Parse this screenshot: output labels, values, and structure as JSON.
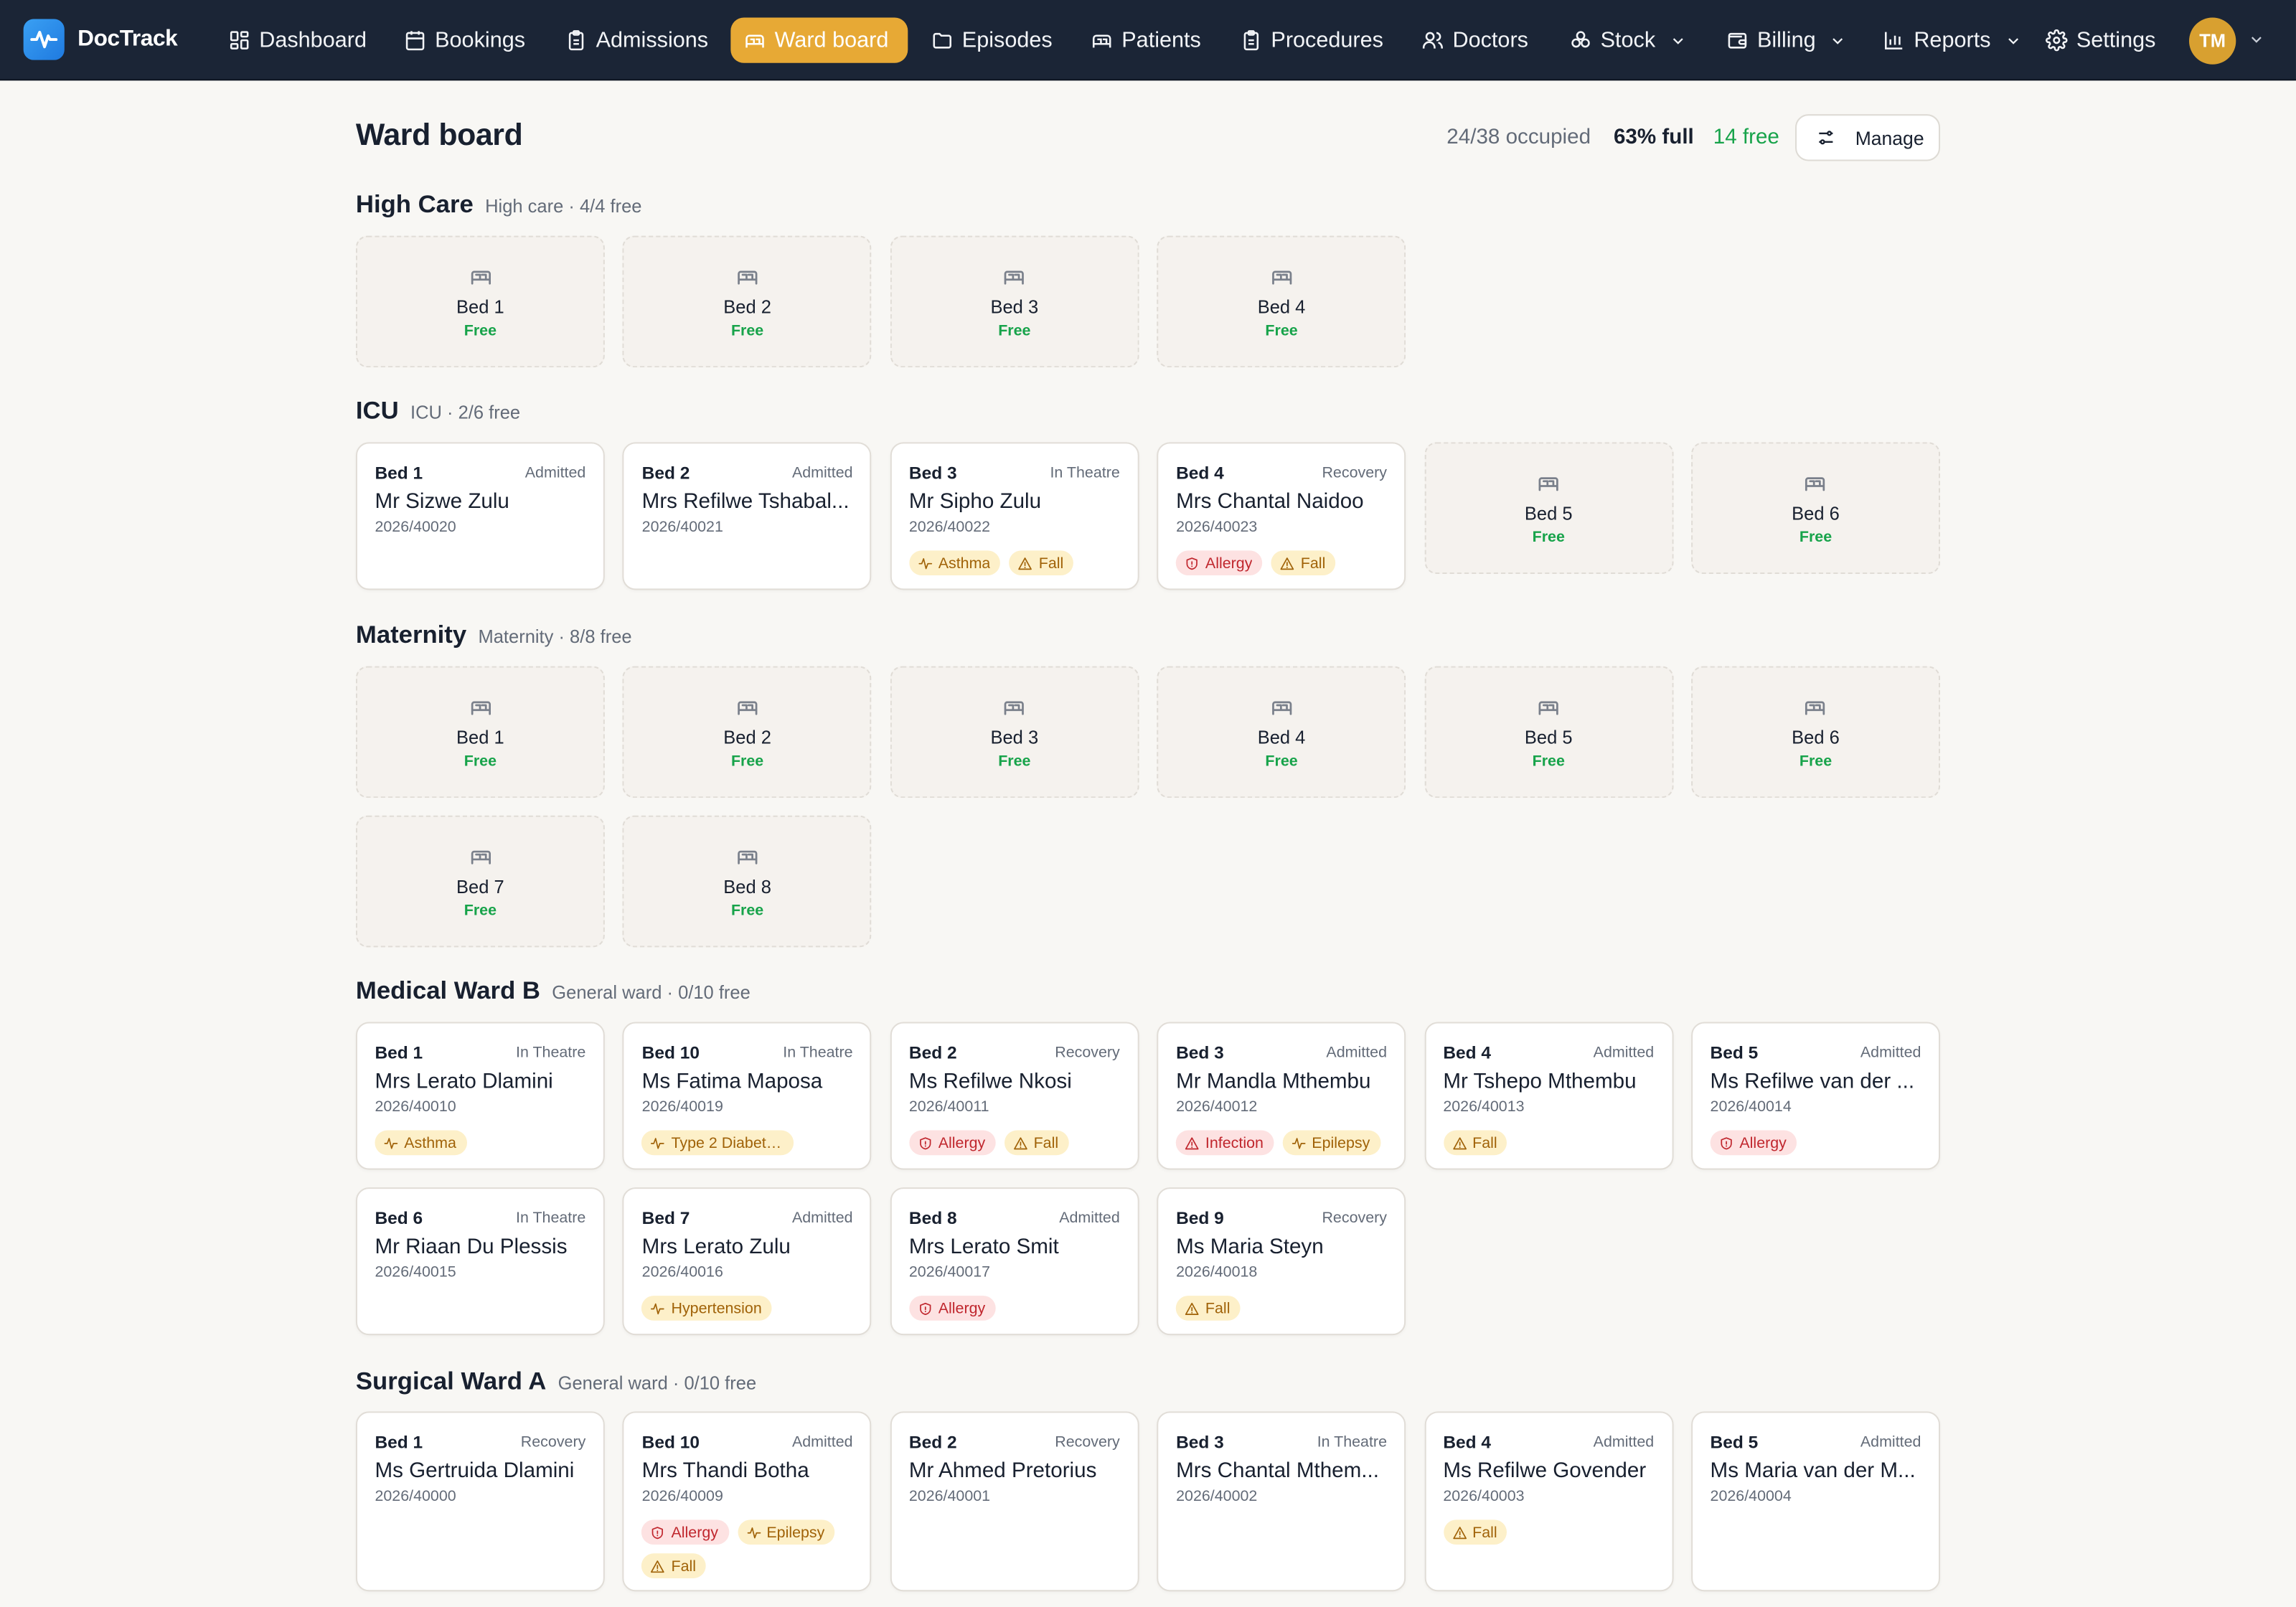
{
  "app": {
    "name": "DocTrack"
  },
  "nav": {
    "items": [
      {
        "label": "Dashboard",
        "icon": "dashboard-icon"
      },
      {
        "label": "Bookings",
        "icon": "calendar-icon"
      },
      {
        "label": "Admissions",
        "icon": "clipboard-icon"
      },
      {
        "label": "Ward board",
        "icon": "bed-icon",
        "active": true
      },
      {
        "label": "Episodes",
        "icon": "folder-icon"
      },
      {
        "label": "Patients",
        "icon": "bed-icon"
      },
      {
        "label": "Procedures",
        "icon": "clipboard-icon"
      },
      {
        "label": "Doctors",
        "icon": "users-icon"
      },
      {
        "label": "Stock",
        "icon": "boxes-icon",
        "dropdown": true
      },
      {
        "label": "Billing",
        "icon": "wallet-icon",
        "dropdown": true
      },
      {
        "label": "Reports",
        "icon": "bar-chart-icon",
        "dropdown": true
      },
      {
        "label": "Settings",
        "icon": "gear-icon"
      }
    ],
    "user_initials": "TM"
  },
  "header": {
    "title": "Ward board",
    "occupied": "24/38 occupied",
    "full": "63% full",
    "free": "14 free",
    "manage_label": "Manage"
  },
  "colors": {
    "nav_bg": "#1b2536",
    "accent": "#e7a935",
    "free": "#17a34a",
    "alert_red": "#c0262d",
    "alert_amber": "#a06208"
  },
  "wards": [
    {
      "name": "High Care",
      "summary": "High care · 4/4 free",
      "beds": [
        {
          "bed": "Bed 1",
          "free": true,
          "status": "Free"
        },
        {
          "bed": "Bed 2",
          "free": true,
          "status": "Free"
        },
        {
          "bed": "Bed 3",
          "free": true,
          "status": "Free"
        },
        {
          "bed": "Bed 4",
          "free": true,
          "status": "Free"
        }
      ]
    },
    {
      "name": "ICU",
      "summary": "ICU · 2/6 free",
      "beds": [
        {
          "bed": "Bed 1",
          "status": "Admitted",
          "patient": "Mr Sizwe Zulu",
          "ref": "2026/40020",
          "tags": []
        },
        {
          "bed": "Bed 2",
          "status": "Admitted",
          "patient": "Mrs Refilwe Tshabal...",
          "ref": "2026/40021",
          "tags": []
        },
        {
          "bed": "Bed 3",
          "status": "In Theatre",
          "patient": "Mr Sipho Zulu",
          "ref": "2026/40022",
          "tags": [
            {
              "label": "Asthma",
              "kind": "amber",
              "icon": "pulse-icon"
            },
            {
              "label": "Fall",
              "kind": "amber",
              "icon": "warning-icon"
            }
          ]
        },
        {
          "bed": "Bed 4",
          "status": "Recovery",
          "patient": "Mrs Chantal Naidoo",
          "ref": "2026/40023",
          "tags": [
            {
              "label": "Allergy",
              "kind": "red",
              "icon": "shield-icon"
            },
            {
              "label": "Fall",
              "kind": "amber",
              "icon": "warning-icon"
            }
          ]
        },
        {
          "bed": "Bed 5",
          "free": true,
          "status": "Free"
        },
        {
          "bed": "Bed 6",
          "free": true,
          "status": "Free"
        }
      ]
    },
    {
      "name": "Maternity",
      "summary": "Maternity · 8/8 free",
      "beds": [
        {
          "bed": "Bed 1",
          "free": true,
          "status": "Free"
        },
        {
          "bed": "Bed 2",
          "free": true,
          "status": "Free"
        },
        {
          "bed": "Bed 3",
          "free": true,
          "status": "Free"
        },
        {
          "bed": "Bed 4",
          "free": true,
          "status": "Free"
        },
        {
          "bed": "Bed 5",
          "free": true,
          "status": "Free"
        },
        {
          "bed": "Bed 6",
          "free": true,
          "status": "Free"
        },
        {
          "bed": "Bed 7",
          "free": true,
          "status": "Free"
        },
        {
          "bed": "Bed 8",
          "free": true,
          "status": "Free"
        }
      ]
    },
    {
      "name": "Medical Ward B",
      "summary": "General ward · 0/10 free",
      "beds": [
        {
          "bed": "Bed 1",
          "status": "In Theatre",
          "patient": "Mrs Lerato Dlamini",
          "ref": "2026/40010",
          "tags": [
            {
              "label": "Asthma",
              "kind": "amber",
              "icon": "pulse-icon"
            }
          ]
        },
        {
          "bed": "Bed 10",
          "status": "In Theatre",
          "patient": "Ms Fatima Maposa",
          "ref": "2026/40019",
          "tags": [
            {
              "label": "Type 2 Diabete...",
              "kind": "amber",
              "icon": "pulse-icon"
            }
          ]
        },
        {
          "bed": "Bed 2",
          "status": "Recovery",
          "patient": "Ms Refilwe Nkosi",
          "ref": "2026/40011",
          "tags": [
            {
              "label": "Allergy",
              "kind": "red",
              "icon": "shield-icon"
            },
            {
              "label": "Fall",
              "kind": "amber",
              "icon": "warning-icon"
            }
          ]
        },
        {
          "bed": "Bed 3",
          "status": "Admitted",
          "patient": "Mr Mandla Mthembu",
          "ref": "2026/40012",
          "tags": [
            {
              "label": "Infection",
              "kind": "red",
              "icon": "warning-icon"
            },
            {
              "label": "Epilepsy",
              "kind": "amber",
              "icon": "pulse-icon"
            }
          ]
        },
        {
          "bed": "Bed 4",
          "status": "Admitted",
          "patient": "Mr Tshepo Mthembu",
          "ref": "2026/40013",
          "tags": [
            {
              "label": "Fall",
              "kind": "amber",
              "icon": "warning-icon"
            }
          ]
        },
        {
          "bed": "Bed 5",
          "status": "Admitted",
          "patient": "Ms Refilwe van der ...",
          "ref": "2026/40014",
          "tags": [
            {
              "label": "Allergy",
              "kind": "red",
              "icon": "shield-icon"
            }
          ]
        },
        {
          "bed": "Bed 6",
          "status": "In Theatre",
          "patient": "Mr Riaan Du Plessis",
          "ref": "2026/40015",
          "tags": []
        },
        {
          "bed": "Bed 7",
          "status": "Admitted",
          "patient": "Mrs Lerato Zulu",
          "ref": "2026/40016",
          "tags": [
            {
              "label": "Hypertension",
              "kind": "amber",
              "icon": "pulse-icon"
            }
          ]
        },
        {
          "bed": "Bed 8",
          "status": "Admitted",
          "patient": "Mrs Lerato Smit",
          "ref": "2026/40017",
          "tags": [
            {
              "label": "Allergy",
              "kind": "red",
              "icon": "shield-icon"
            }
          ]
        },
        {
          "bed": "Bed 9",
          "status": "Recovery",
          "patient": "Ms Maria Steyn",
          "ref": "2026/40018",
          "tags": [
            {
              "label": "Fall",
              "kind": "amber",
              "icon": "warning-icon"
            }
          ]
        }
      ]
    },
    {
      "name": "Surgical Ward A",
      "summary": "General ward · 0/10 free",
      "beds": [
        {
          "bed": "Bed 1",
          "status": "Recovery",
          "patient": "Ms Gertruida Dlamini",
          "ref": "2026/40000",
          "tags": []
        },
        {
          "bed": "Bed 10",
          "status": "Admitted",
          "patient": "Mrs Thandi Botha",
          "ref": "2026/40009",
          "tags": [
            {
              "label": "Allergy",
              "kind": "red",
              "icon": "shield-icon"
            },
            {
              "label": "Epilepsy",
              "kind": "amber",
              "icon": "pulse-icon"
            },
            {
              "label": "Fall",
              "kind": "amber",
              "icon": "warning-icon"
            }
          ]
        },
        {
          "bed": "Bed 2",
          "status": "Recovery",
          "patient": "Mr Ahmed Pretorius",
          "ref": "2026/40001",
          "tags": []
        },
        {
          "bed": "Bed 3",
          "status": "In Theatre",
          "patient": "Mrs Chantal Mthem...",
          "ref": "2026/40002",
          "tags": []
        },
        {
          "bed": "Bed 4",
          "status": "Admitted",
          "patient": "Ms Refilwe Govender",
          "ref": "2026/40003",
          "tags": [
            {
              "label": "Fall",
              "kind": "amber",
              "icon": "warning-icon"
            }
          ]
        },
        {
          "bed": "Bed 5",
          "status": "Admitted",
          "patient": "Ms Maria van der M...",
          "ref": "2026/40004",
          "tags": []
        }
      ]
    }
  ]
}
